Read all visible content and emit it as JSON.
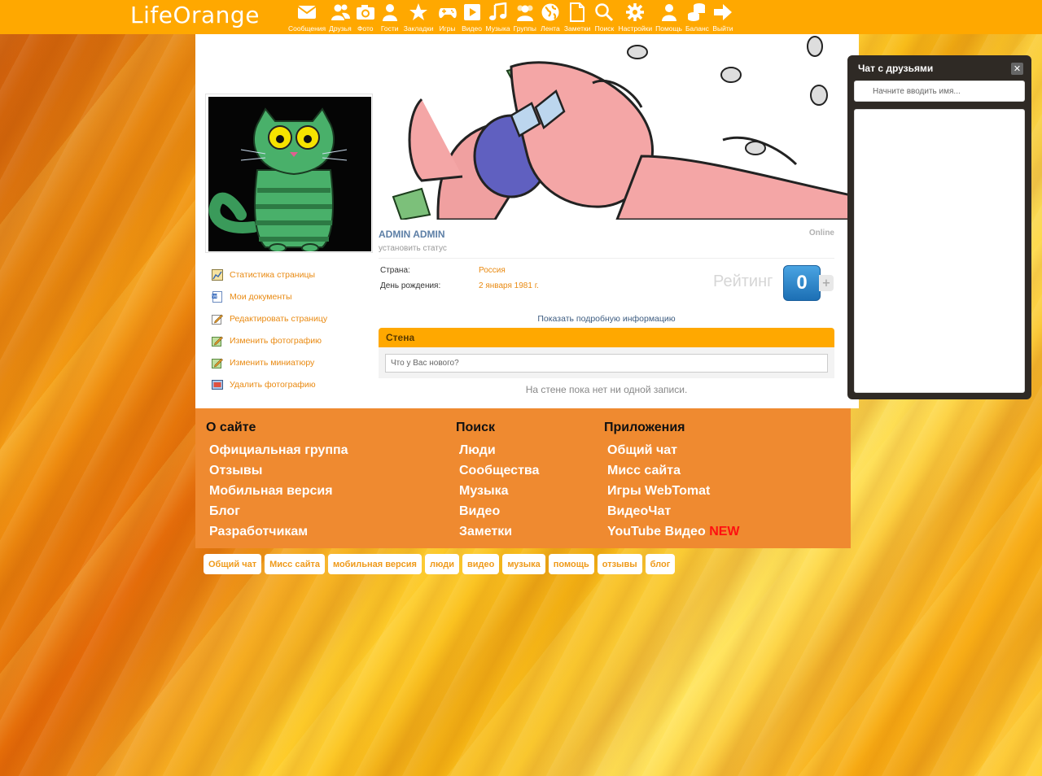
{
  "app": {
    "logo": "LifeOrange"
  },
  "nav": [
    {
      "label": "Сообщения",
      "icon": "envelope-icon"
    },
    {
      "label": "Друзья",
      "icon": "friends-icon"
    },
    {
      "label": "Фото",
      "icon": "camera-icon"
    },
    {
      "label": "Гости",
      "icon": "guest-icon"
    },
    {
      "label": "Закладки",
      "icon": "star-icon"
    },
    {
      "label": "Игры",
      "icon": "gamepad-icon"
    },
    {
      "label": "Видео",
      "icon": "play-icon"
    },
    {
      "label": "Музыка",
      "icon": "music-note-icon"
    },
    {
      "label": "Группы",
      "icon": "groups-icon"
    },
    {
      "label": "Лента",
      "icon": "globe-icon"
    },
    {
      "label": "Заметки",
      "icon": "note-icon"
    },
    {
      "label": "Поиск",
      "icon": "search-icon"
    },
    {
      "label": "Настройки",
      "icon": "gear-icon"
    },
    {
      "label": "Помощь",
      "icon": "help-person-icon"
    },
    {
      "label": "Баланс",
      "icon": "coins-icon"
    },
    {
      "label": "Выйти",
      "icon": "exit-arrow-icon"
    }
  ],
  "profile": {
    "name": "ADMIN ADMIN",
    "status_link": "установить статус",
    "online": "Online",
    "country_label": "Страна:",
    "country_value": "Россия",
    "birthday_label": "День рождения:",
    "birthday_value": "2 января 1981 г.",
    "rating_label": "Рейтинг",
    "rating_value": "0",
    "rating_plus": "+",
    "more_info": "Показать подробную информацию"
  },
  "side_links": [
    {
      "label": "Статистика страницы",
      "icon": "stats-icon"
    },
    {
      "label": "Мои документы",
      "icon": "document-icon"
    },
    {
      "label": "Редактировать страницу",
      "icon": "edit-icon"
    },
    {
      "label": "Изменить фотографию",
      "icon": "edit-photo-icon"
    },
    {
      "label": "Изменить миниатюру",
      "icon": "edit-thumbnail-icon"
    },
    {
      "label": "Удалить фотографию",
      "icon": "delete-photo-icon"
    }
  ],
  "wall": {
    "title": "Стена",
    "placeholder": "Что у Вас нового?",
    "empty": "На стене пока нет ни одной записи."
  },
  "footer": {
    "col1": {
      "title": "О сайте",
      "links": [
        "Официальная группа",
        "Отзывы",
        "Мобильная версия",
        "Блог",
        "Разработчикам"
      ]
    },
    "col2": {
      "title": "Поиск",
      "links": [
        "Люди",
        "Сообщества",
        "Музыка",
        "Видео",
        "Заметки"
      ]
    },
    "col3": {
      "title": "Приложения",
      "links": [
        "Общий чат",
        "Мисс сайта",
        "Игры WebTomat",
        "ВидеоЧат",
        "YouTube Видео"
      ],
      "new_badge": "NEW"
    }
  },
  "tags": [
    "Общий чат",
    "Мисс сайта",
    "мобильная версия",
    "люди",
    "видео",
    "музыка",
    "помощь",
    "отзывы",
    "блог"
  ],
  "chat": {
    "title": "Чат с друзьями",
    "close": "✕",
    "search_placeholder": "Начните вводить имя..."
  },
  "colors": {
    "accent": "#ffa800",
    "footer": "#ef8a30",
    "link": "#e98a12"
  }
}
